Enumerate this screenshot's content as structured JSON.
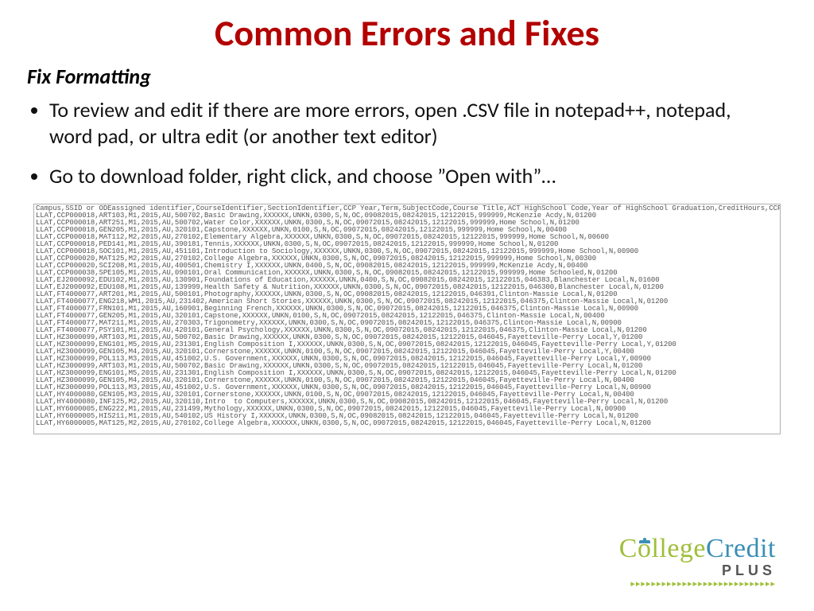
{
  "title": "Common Errors and Fixes",
  "subtitle": "Fix Formatting",
  "bullets": [
    "To review and edit if there are more errors, open .CSV file in notepad++, notepad, word pad, or ultra edit (or another text editor)",
    "Go to download folder, right click, and choose ”Open with”…"
  ],
  "csv_header": "Campus,SSID or ODEassigned identifier,CourseIdentifier,SectionIdentifier,CCP Year,Term,SubjectCode,Course Title,ACT HighSchool Code,Year of HighSchool Graduation,CreditHours,CCP Credit",
  "csv_rows": [
    "LLAT,CCP000018,ART103,M1,2015,AU,500702,Basic Drawing,XXXXXX,UNKN,0300,S,N,OC,09082015,08242015,12122015,999999,McKenzie Acdy,N,01200",
    "LLAT,CCP000018,ART251,M1,2015,AU,500702,Water Color,XXXXXX,UNKN,0300,S,N,OC,09072015,08242015,12122015,999999,Home School,N,01200",
    "LLAT,CCP000018,GEN205,M1,2015,AU,320101,Capstone,XXXXXX,UNKN,0100,S,N,OC,09072015,08242015,12122015,999999,Home School,N,00400",
    "LLAT,CCP000018,MAT112,M2,2015,AU,270102,Elementary Algebra,XXXXXX,UNKN,0300,S,N,OC,09072015,08242015,12122015,999999,Home School,N,00600",
    "LLAT,CCP000018,PED141,M1,2015,AU,390181,Tennis,XXXXXX,UNKN,0300,S,N,OC,09072015,08242015,12122015,999999,Home School,N,01200",
    "LLAT,CCP000018,SOC101,M1,2015,AU,451101,Introduction to Sociology,XXXXXX,UNKN,0300,S,N,OC,09072015,08242015,12122015,999999,Home School,N,00900",
    "LLAT,CCP000020,MAT125,M2,2015,AU,270102,College Algebra,XXXXXX,UNKN,0300,S,N,OC,09072015,08242015,12122015,999999,Home School,N,00300",
    "LLAT,CCP000020,SCI208,M1,2015,AU,400501,Chemistry I,XXXXXX,UNKN,0400,S,N,OC,09082015,08242015,12122015,999999,McKenzie Acdy,N,00400",
    "LLAT,CCP000038,SPE105,M1,2015,AU,090101,Oral Communication,XXXXXX,UNKN,0300,S,N,OC,09082015,08242015,12122015,999999,Home Schooled,N,01200",
    "LLAT,EJ2000092,EDU102,M1,2015,AU,130901,Foundations of Education,XXXXXX,UNKN,0400,S,N,OC,09082015,08242015,12122015,046383,Blanchester Local,N,01600",
    "LLAT,EJ2000092,EDU108,M1,2015,AU,139999,Health Safety & Nutrition,XXXXXX,UNKN,0300,S,N,OC,09072015,08242015,12122015,046300,Blanchester Local,N,01200",
    "LLAT,FT4000077,ART201,M1,2015,AU,500101,Photography,XXXXXX,UNKN,0300,S,N,OC,09082015,08242015,12122015,046391,Clinton-Massie Local,N,01200",
    "LLAT,FT4000077,ENG218,WM1,2015,AU,231402,American Short Stories,XXXXXX,UNKN,0300,S,N,OC,09072015,08242015,12122015,046375,Clinton-Massie Local,N,01200",
    "LLAT,FT4000077,FRN101,M1,2015,AU,160901,Beginning French,XXXXXX,UNKN,0300,S,N,OC,09072015,08242015,12122015,046375,Clinton-Massie Local,N,00900",
    "LLAT,FT4000077,GEN205,M1,2015,AU,320101,Capstone,XXXXXX,UNKN,0100,S,N,OC,09072015,08242015,12122015,046375,Clinton-Massie Local,N,00400",
    "LLAT,FT4000077,MAT211,M1,2015,AU,270303,Trigonometry,XXXXXX,UNKN,0300,S,N,OC,09072015,08242015,12122015,046375,Clinton-Massie Local,N,00900",
    "LLAT,FT4000077,PSY101,M1,2015,AU,420101,General Psychology,XXXXXX,UNKN,0300,S,N,OC,09072015,08242015,12122015,046375,Clinton-Massie Local,N,01200",
    "LLAT,HZ3000099,ART103,M1,2015,AU,500702,Basic Drawing,XXXXXX,UNKN,0300,S,N,OC,09072015,08242015,12122015,046045,Fayetteville-Perry Local,Y,01200",
    "LLAT,HZ3000099,ENG101,M5,2015,AU,231301,English Composition I,XXXXXX,UNKN,0300,S,N,OC,09072015,08242015,12122015,046045,Fayetteville-Perry Local,Y,01200",
    "LLAT,HZ3000099,GEN105,M4,2015,AU,320101,Cornerstone,XXXXXX,UNKN,0100,S,N,OC,09072015,08242015,12122015,046045,Fayetteville-Perry Local,Y,00400",
    "LLAT,HZ3000099,POL113,M3,2015,AU,451002,U.S. Government,XXXXXX,UNKN,0300,S,N,OC,09072015,08242015,12122015,046045,Fayetteville-Perry Local,Y,00900",
    "LLAT,HZ3000099,ART103,M1,2015,AU,500702,Basic Drawing,XXXXXX,UNKN,0300,S,N,OC,09072015,08242015,12122015,046045,Fayetteville-Perry Local,N,01200",
    "LLAT,HZ3000099,ENG101,M5,2015,AU,231301,English Composition I,XXXXXX,UNKN,0300,S,N,OC,09072015,08242015,12122015,046045,Fayetteville-Perry Local,N,01200",
    "LLAT,HZ3000099,GEN105,M4,2015,AU,320101,Cornerstone,XXXXXX,UNKN,0100,S,N,OC,09072015,08242015,12122015,046045,Fayetteville-Perry Local,N,00400",
    "LLAT,HZ3000099,POL113,M3,2015,AU,451002,U.S. Government,XXXXXX,UNKN,0300,S,N,OC,09072015,08242015,12122015,046045,Fayetteville-Perry Local,N,00900",
    "LLAT,HY4000080,GEN105,M3,2015,AU,320101,Cornerstone,XXXXXX,UNKN,0100,S,N,OC,09072015,08242015,12122015,046045,Fayetteville-Perry Local,N,00400",
    "LLAT,HY4000080,INF125,M2,2015,AU,320110,Intro  to Computers,XXXXXX,UNKN,0300,S,N,OC,09082015,08242015,12122015,046045,Fayetteville-Perry Local,N,01200",
    "LLAT,HY6000005,ENG222,M1,2015,AU,231499,Mythology,XXXXXX,UNKN,0300,S,N,OC,09072015,08242015,12122015,046045,Fayetteville-Perry Local,N,00900",
    "LLAT,HY6000005,HIS211,M1,2015,AU,540102,US History I,XXXXXX,UNKN,0300,S,N,OC,09082015,08242015,12122015,046045,Fayetteville-Perry Local,N,01200",
    "LLAT,HY6000005,MAT125,M2,2015,AU,270102,College Algebra,XXXXXX,UNKN,0300,S,N,OC,09072015,08242015,12122015,046045,Fayetteville-Perry Local,N,01200"
  ],
  "logo": {
    "word1": "C",
    "word1b": "llege",
    "word2": "Credit",
    "sub": "PLUS"
  }
}
